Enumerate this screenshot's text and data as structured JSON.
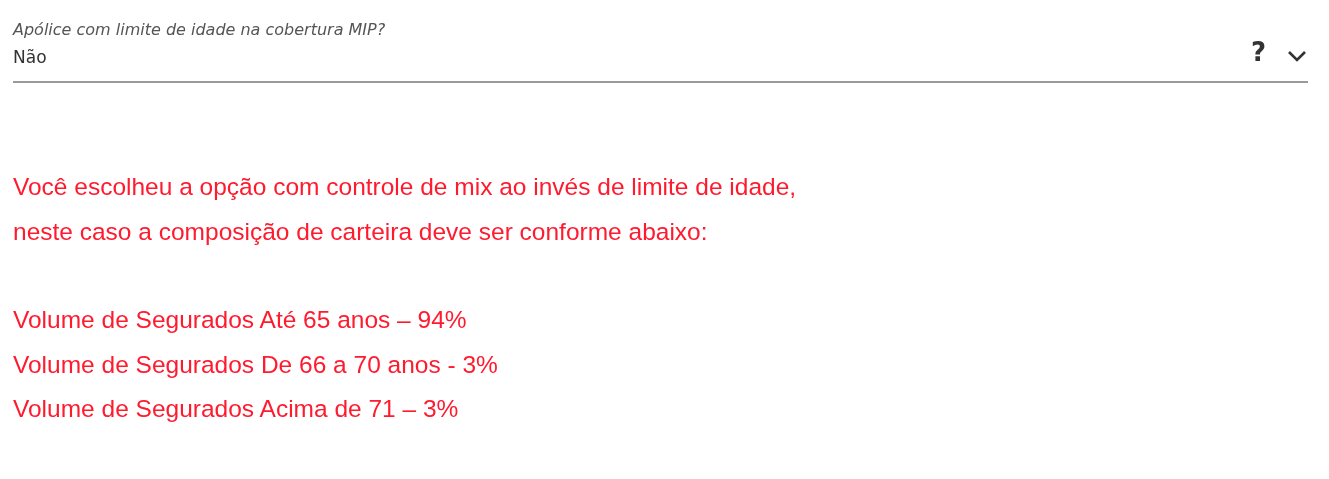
{
  "select": {
    "label": "Apólice com limite de idade na cobertura MIP?",
    "value": "Não",
    "help": "?"
  },
  "warning": {
    "lines": [
      "Você escolheu a opção com controle de mix ao invés de limite de idade,",
      "neste caso a composição de carteira deve ser conforme abaixo:"
    ],
    "items": [
      "Volume de Segurados Até 65 anos – 94%",
      "Volume de Segurados De 66 a 70 anos - 3%",
      "Volume de Segurados Acima de 71 – 3%"
    ]
  }
}
